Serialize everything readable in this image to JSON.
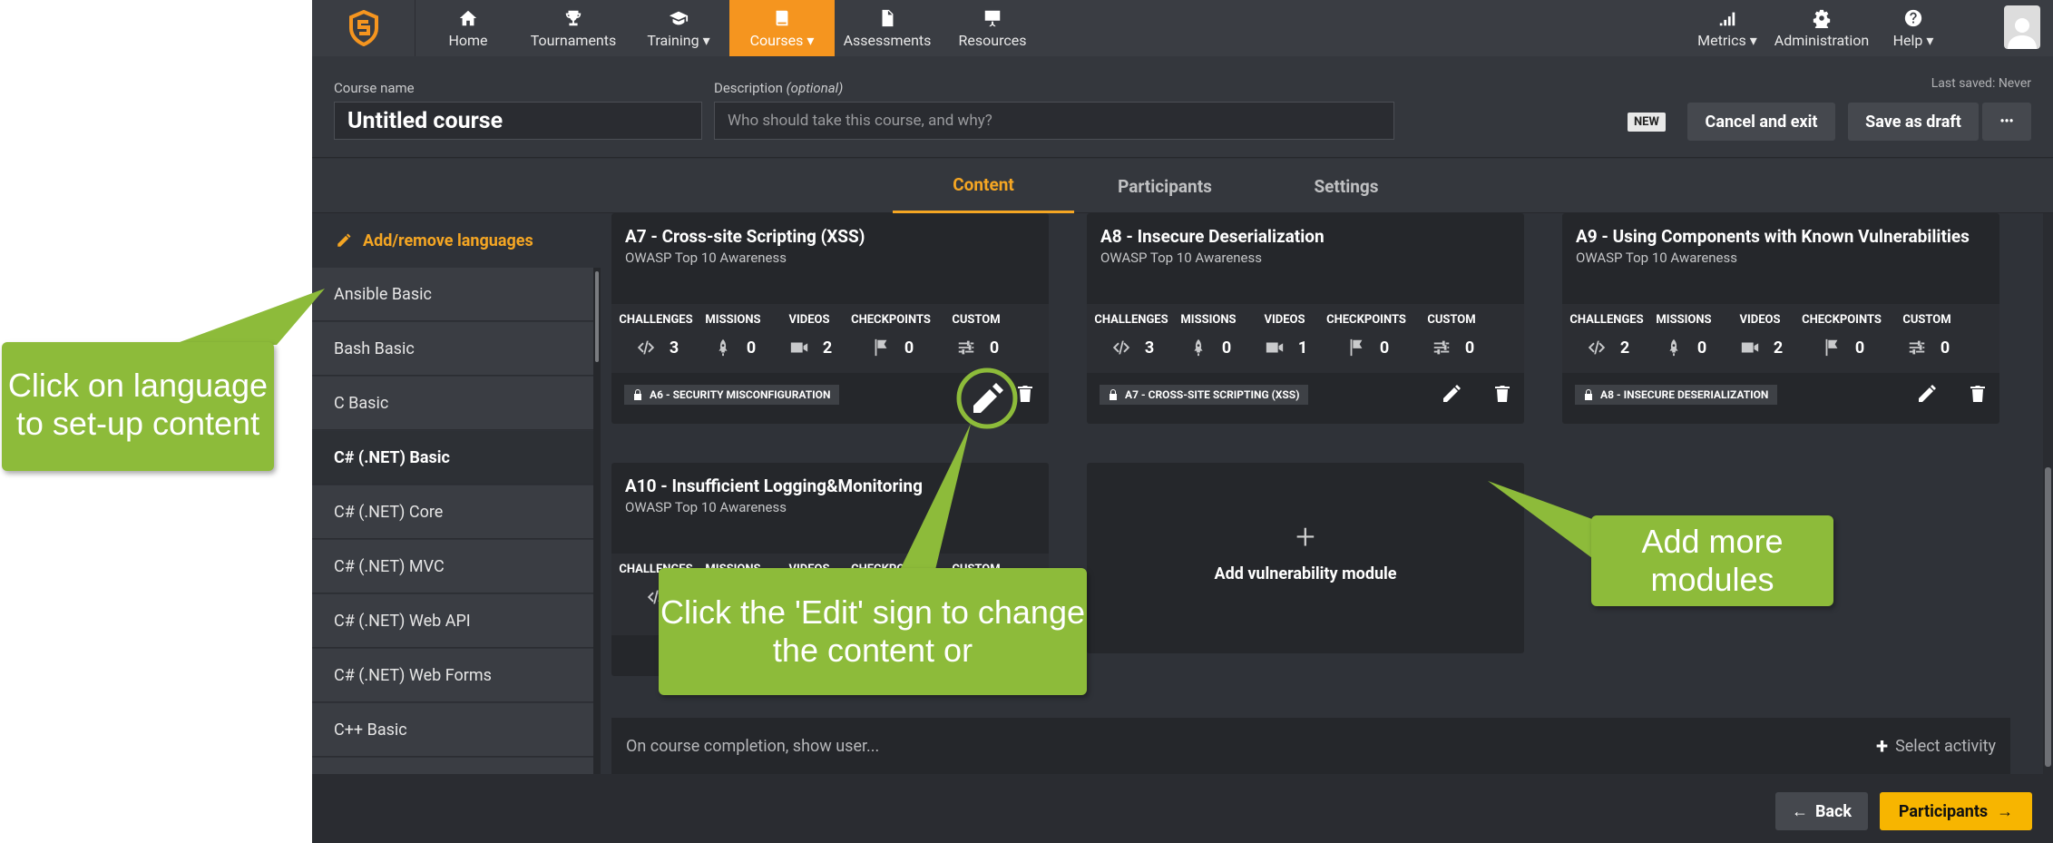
{
  "nav": {
    "items": [
      {
        "label": "Home",
        "icon": "home-icon"
      },
      {
        "label": "Tournaments",
        "icon": "trophy-icon"
      },
      {
        "label": "Training ▾",
        "icon": "graduation-cap-icon"
      },
      {
        "label": "Courses ▾",
        "icon": "book-icon",
        "active": true
      },
      {
        "label": "Assessments",
        "icon": "document-icon"
      },
      {
        "label": "Resources",
        "icon": "presentation-icon"
      }
    ],
    "right": [
      {
        "label": "Metrics ▾",
        "icon": "signal-icon"
      },
      {
        "label": "Administration",
        "icon": "gear-icon"
      },
      {
        "label": "Help ▾",
        "icon": "question-icon"
      }
    ]
  },
  "header": {
    "course_name_label": "Course name",
    "course_name_value": "Untitled course",
    "description_label": "Description",
    "description_optional": "(optional)",
    "description_placeholder": "Who should take this course, and why?",
    "last_saved": "Last saved: Never",
    "new_badge": "NEW",
    "cancel": "Cancel and exit",
    "save_draft": "Save as draft",
    "more": "•••"
  },
  "tabs": [
    "Content",
    "Participants",
    "Settings"
  ],
  "sidebar": {
    "add_languages": "Add/remove languages",
    "languages": [
      "Ansible Basic",
      "Bash Basic",
      "C Basic",
      "C# (.NET) Basic",
      "C# (.NET) Core",
      "C# (.NET) MVC",
      "C# (.NET) Web API",
      "C# (.NET) Web Forms",
      "C++ Basic"
    ]
  },
  "stat_labels": [
    "CHALLENGES",
    "MISSIONS",
    "VIDEOS",
    "CHECKPOINTS",
    "CUSTOM"
  ],
  "modules": [
    {
      "title": "A7 - Cross-site Scripting (XSS)",
      "subtitle": "OWASP Top 10 Awareness",
      "values": [
        "3",
        "0",
        "2",
        "0",
        "0"
      ],
      "lock": "A6 - SECURITY MISCONFIGURATION"
    },
    {
      "title": "A8 - Insecure Deserialization",
      "subtitle": "OWASP Top 10 Awareness",
      "values": [
        "3",
        "0",
        "1",
        "0",
        "0"
      ],
      "lock": "A7 - CROSS-SITE SCRIPTING (XSS)"
    },
    {
      "title": "A9 - Using Components with Known Vulnerabilities",
      "subtitle": "OWASP Top 10 Awareness",
      "values": [
        "2",
        "0",
        "2",
        "0",
        "0"
      ],
      "lock": "A8 - INSECURE DESERIALIZATION"
    },
    {
      "title": "A10 - Insufficient Logging&Monitoring",
      "subtitle": "OWASP Top 10 Awareness",
      "stat_partial": [
        "CHALLENGES",
        "MISSIONS",
        "VIDEOS",
        "CHECKPOINTS",
        "CUSTOM"
      ]
    }
  ],
  "add_module": {
    "label": "Add vulnerability module"
  },
  "completion": {
    "text": "On course completion, show user...",
    "action": "Select activity"
  },
  "footer": {
    "back": "Back",
    "next": "Participants"
  },
  "callouts": {
    "language": "Click on language to set-up content",
    "edit": "Click the 'Edit' sign to change the content or",
    "add": "Add more modules"
  },
  "colors": {
    "accent": "#f5951f",
    "callout": "#8dbb3a",
    "next_button": "#f7b500"
  }
}
